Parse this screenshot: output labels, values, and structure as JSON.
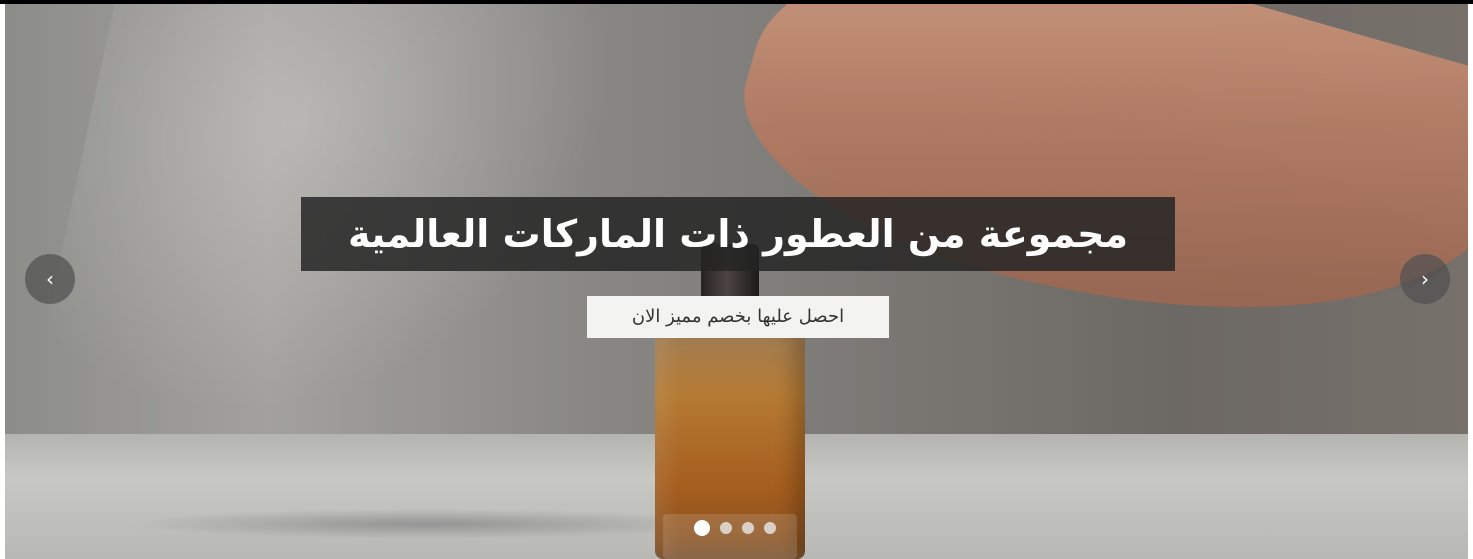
{
  "carousel": {
    "title": "مجموعة من العطور ذات الماركات العالمية",
    "subtitle": "احصل عليها بخصم مميز الان",
    "left_arrow": "‹",
    "right_arrow": "›",
    "slides_count": 4,
    "active_slide": 1,
    "colors": {
      "overlay": "#242424",
      "subtitle_bg": "#f3f3f2",
      "arrow_bg": "#505050",
      "dot_active": "#ffffff"
    },
    "icons": {
      "previous": "chevron-left-icon",
      "next": "chevron-right-icon"
    }
  }
}
